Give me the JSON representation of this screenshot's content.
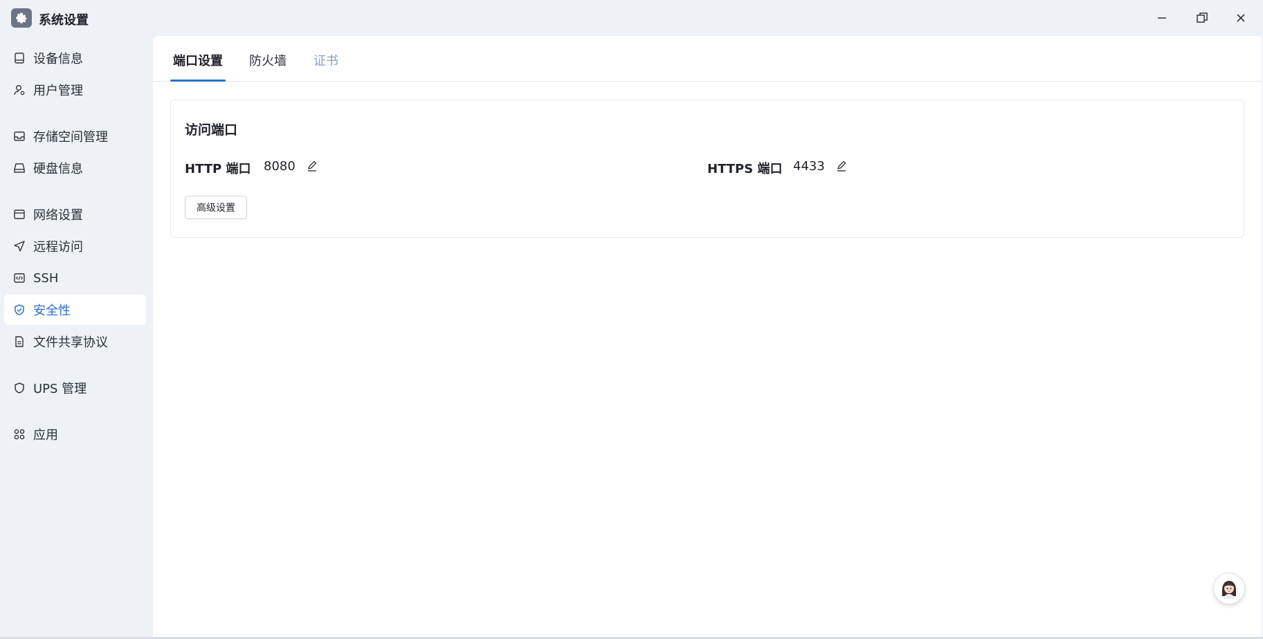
{
  "window": {
    "title": "系统设置",
    "icon": "gear-icon",
    "controls": [
      "minimize-icon",
      "maximize-icon",
      "close-icon"
    ]
  },
  "sidebar": {
    "items": [
      {
        "label": "设备信息",
        "icon": "monitor-icon"
      },
      {
        "label": "用户管理",
        "icon": "user-gear-icon"
      },
      {
        "label": "存储空间管理",
        "icon": "inbox-icon"
      },
      {
        "label": "硬盘信息",
        "icon": "hard-drive-icon"
      },
      {
        "label": "网络设置",
        "icon": "browser-icon"
      },
      {
        "label": "远程访问",
        "icon": "send-icon"
      },
      {
        "label": "SSH",
        "icon": "code-icon"
      },
      {
        "label": "安全性",
        "icon": "shield-check-icon",
        "active": true
      },
      {
        "label": "文件共享协议",
        "icon": "document-icon"
      },
      {
        "label": "UPS 管理",
        "icon": "shield-icon"
      },
      {
        "label": "应用",
        "icon": "apps-icon"
      }
    ]
  },
  "tabs": [
    {
      "label": "端口设置",
      "active": true
    },
    {
      "label": "防火墙"
    },
    {
      "label": "证书",
      "disabled": true
    }
  ],
  "card": {
    "title": "访问端口",
    "http_label": "HTTP 端口",
    "http_value": "8080",
    "https_label": "HTTPS 端口",
    "https_value": "4433",
    "advanced_button": "高级设置"
  },
  "colors": {
    "accent": "#2a6fd1",
    "sidebar_bg": "#eef2f7",
    "disabled_tab": "#8aa0bd"
  }
}
